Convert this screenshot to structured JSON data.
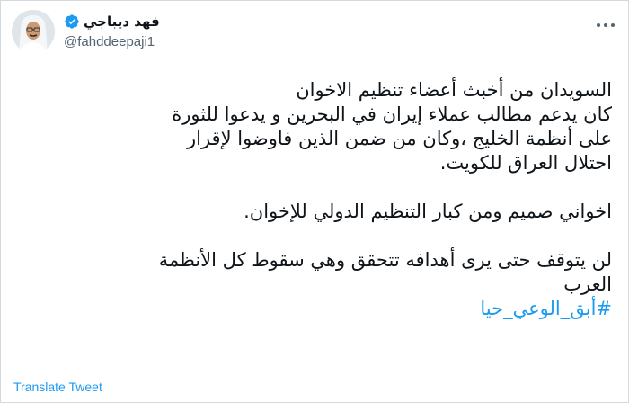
{
  "author": {
    "display_name": "فهد ديباجي",
    "handle": "@fahddeepaji1",
    "avatar_icon": "avatar-photo",
    "verified_icon": "verified-badge-icon"
  },
  "tweet": {
    "paragraph1": [
      "السويدان من أخبث أعضاء تنظيم الاخوان",
      "كان يدعم مطالب عملاء إيران في البحرين و يدعوا للثورة",
      "على أنظمة الخليج ،وكان من ضمن الذين فاوضوا لإقرار",
      "احتلال العراق للكويت."
    ],
    "paragraph2": [
      "اخواني صميم ومن كبار التنظيم الدولي للإخوان."
    ],
    "paragraph3": [
      "لن يتوقف حتى يرى أهدافه تتحقق وهي سقوط كل الأنظمة",
      "العرب"
    ],
    "hashtag": "#أبق_الوعي_حيا"
  },
  "actions": {
    "translate_label": "Translate Tweet",
    "more_icon": "more-options-icon"
  },
  "colors": {
    "text": "#0f1419",
    "secondary": "#536471",
    "accent": "#1d9bf0",
    "border": "#cfd9de"
  }
}
